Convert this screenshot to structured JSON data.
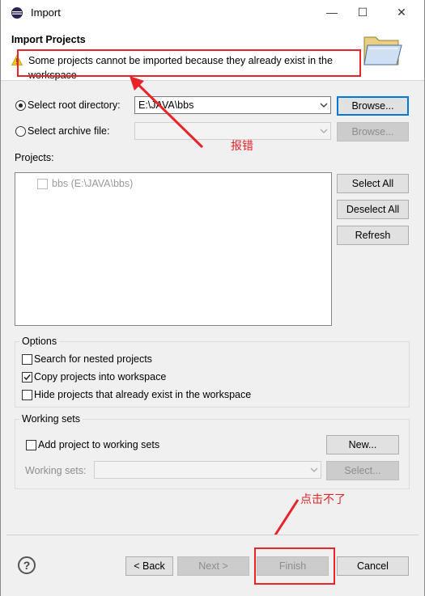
{
  "window": {
    "title": "Import",
    "minimize": "—",
    "maximize": "☐",
    "close": "✕"
  },
  "header": {
    "title": "Import Projects",
    "message": "Some projects cannot be imported because they already exist in the workspace"
  },
  "source": {
    "root_dir_label": "Select root directory:",
    "root_dir_value": "E:\\JAVA\\bbs",
    "root_browse": "Browse...",
    "archive_label": "Select archive file:",
    "archive_value": "",
    "archive_browse": "Browse..."
  },
  "projects": {
    "label": "Projects:",
    "items": [
      {
        "label": "bbs (E:\\JAVA\\bbs)",
        "checked": false,
        "enabled": false
      }
    ],
    "select_all": "Select All",
    "deselect_all": "Deselect All",
    "refresh": "Refresh"
  },
  "options": {
    "title": "Options",
    "search_nested": "Search for nested projects",
    "search_nested_checked": false,
    "copy_into_workspace": "Copy projects into workspace",
    "copy_into_workspace_checked": true,
    "hide_existing": "Hide projects that already exist in the workspace",
    "hide_existing_checked": false
  },
  "working_sets": {
    "title": "Working sets",
    "add_label": "Add project to working sets",
    "add_checked": false,
    "new_button": "New...",
    "sets_label": "Working sets:",
    "sets_value": "",
    "select_button": "Select..."
  },
  "buttons": {
    "help": "?",
    "back": "< Back",
    "next": "Next >",
    "finish": "Finish",
    "cancel": "Cancel"
  },
  "annotations": {
    "error_note": "报错",
    "finish_note": "点击不了"
  },
  "colors": {
    "annotation_red": "#e8232a",
    "focus_blue": "#0078d7"
  }
}
